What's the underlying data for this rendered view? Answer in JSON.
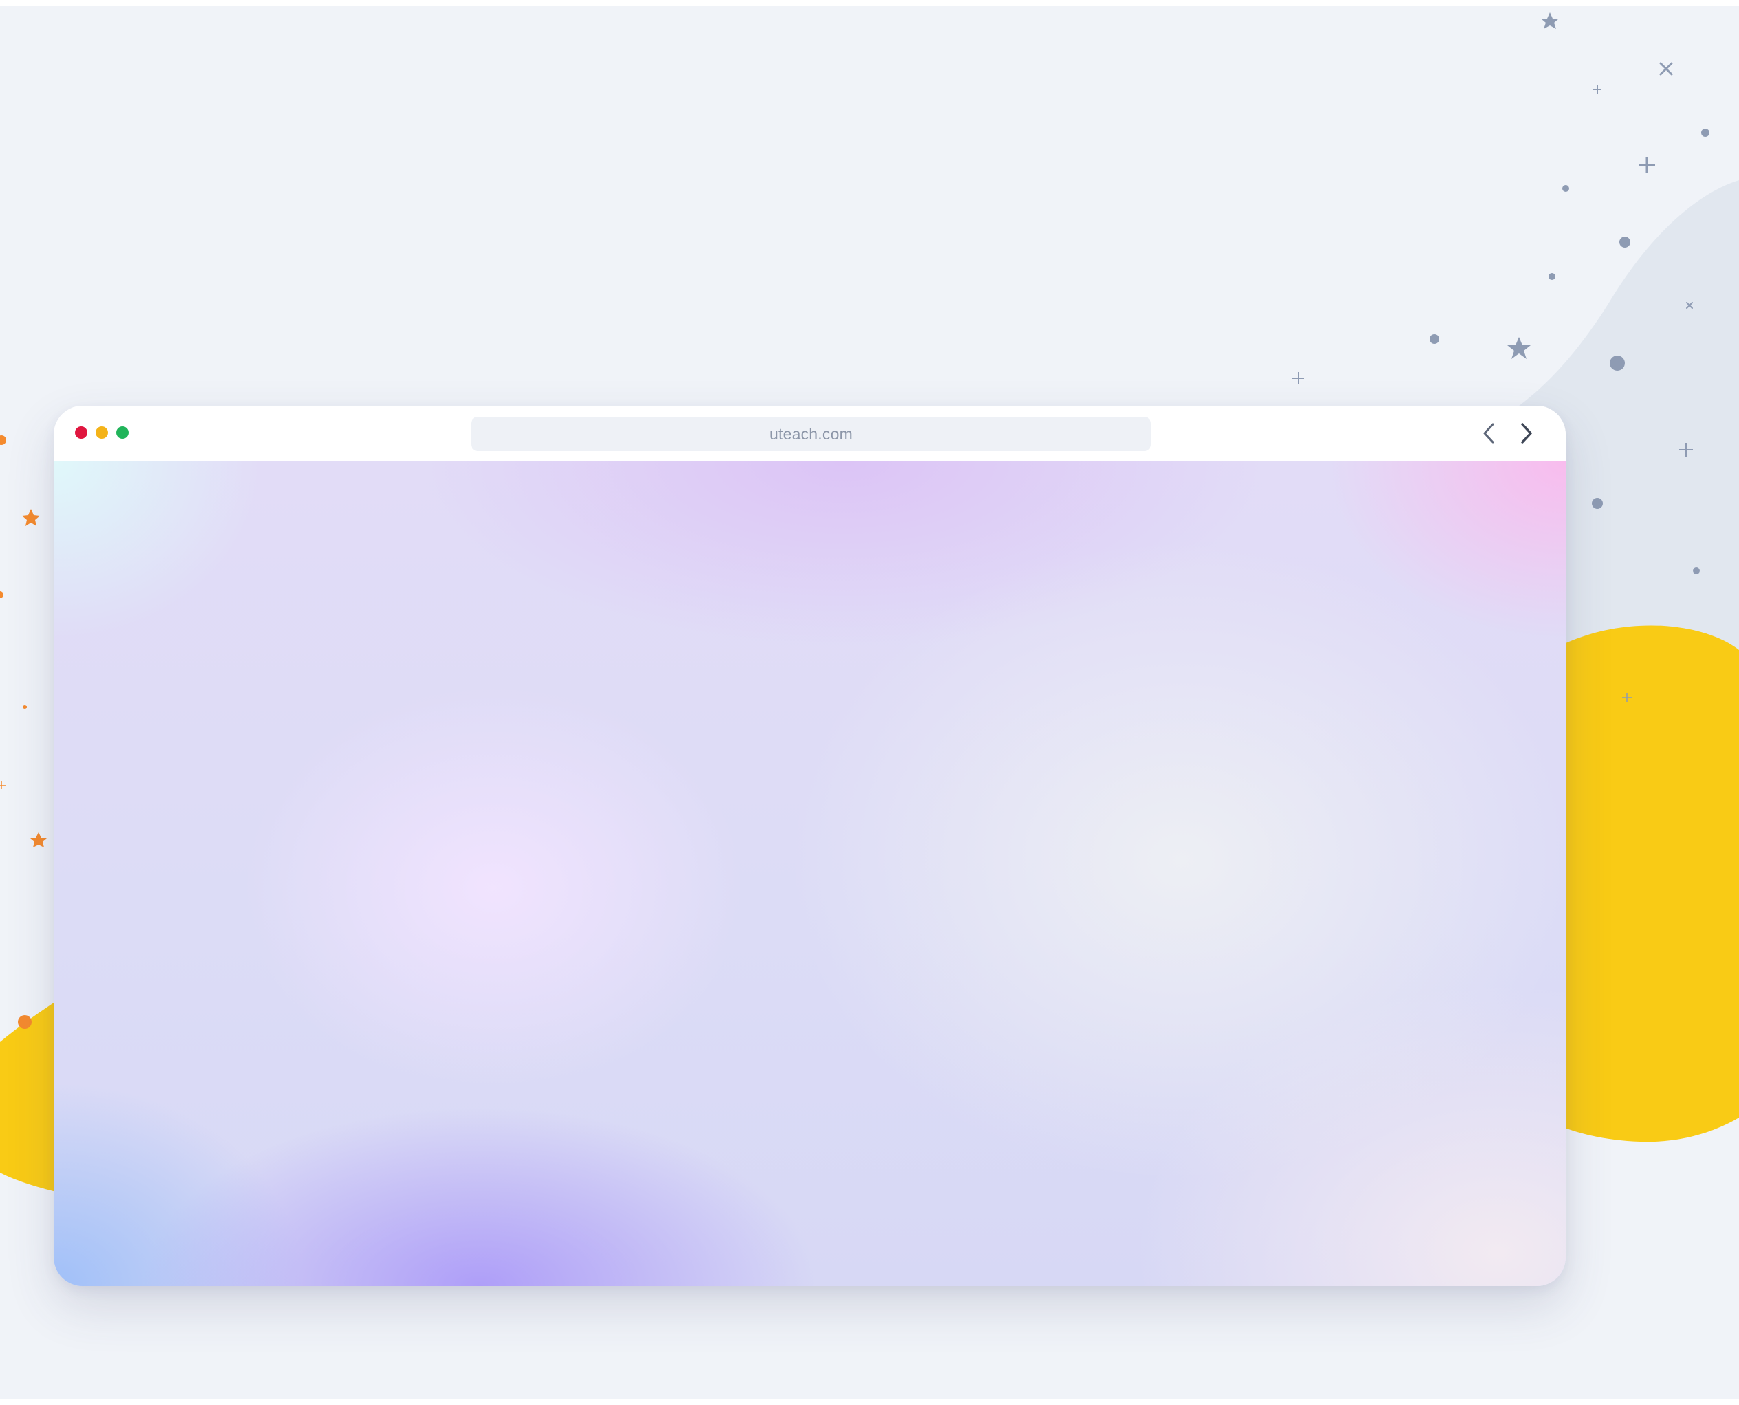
{
  "browser": {
    "address_bar": {
      "url": "uteach.com"
    },
    "window_controls": [
      {
        "name": "close",
        "color": "#e0163f"
      },
      {
        "name": "minimize",
        "color": "#f4b319"
      },
      {
        "name": "maximize",
        "color": "#21b45a"
      }
    ],
    "navigation": {
      "back_icon": "chevron-left-icon",
      "forward_icon": "chevron-right-icon"
    }
  },
  "colors": {
    "page_background": "#f0f3f8",
    "blob_yellow": "#f9cb15",
    "blob_gray": "#e1e7ef",
    "sparkle_gray": "#8e9bb3",
    "sparkle_orange": "#f48a2e"
  }
}
